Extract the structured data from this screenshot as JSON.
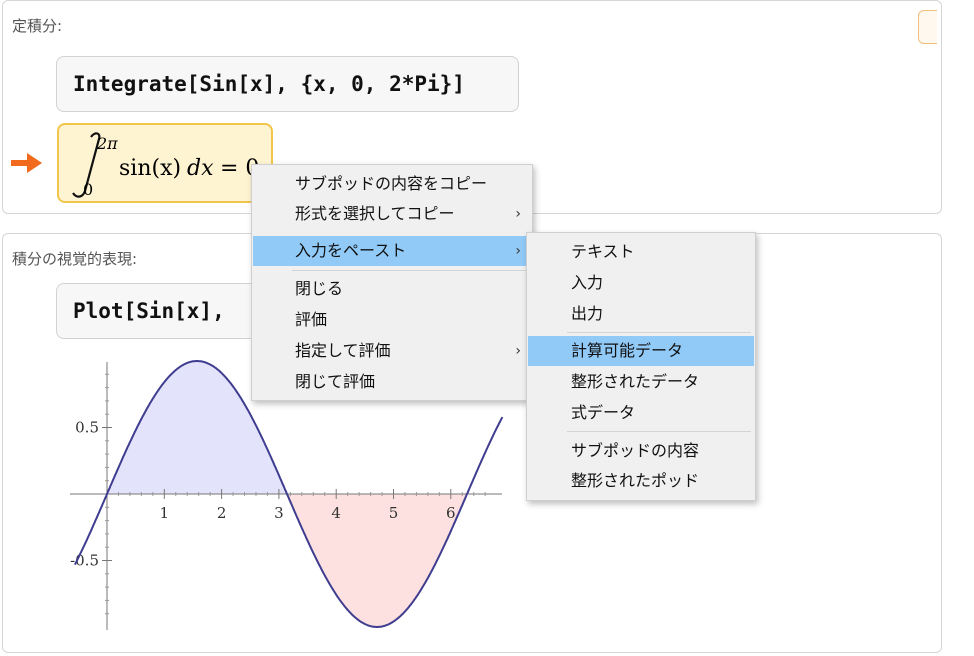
{
  "pod1": {
    "title": "定積分:",
    "input": "Integrate[Sin[x], {x, 0, 2*Pi}]",
    "result": {
      "integrand": "sin(x)",
      "dx": "dx",
      "equals": "= 0",
      "lower": "0",
      "upper": "2π"
    }
  },
  "pod2": {
    "title": "積分の視覚的表現:",
    "input": "Plot[Sin[x],"
  },
  "chart_data": {
    "type": "area",
    "title": "",
    "xlabel": "",
    "ylabel": "",
    "function": "sin(x)",
    "x_ticks": [
      "1",
      "2",
      "3",
      "4",
      "5",
      "6"
    ],
    "y_ticks": [
      "0.5",
      "-0.5"
    ],
    "xlim": [
      -0.65,
      6.9
    ],
    "ylim": [
      -1.2,
      1.2
    ],
    "fill": {
      "from": 0,
      "to": 6.2832,
      "positive_color": "#e3e3fb",
      "negative_color": "#fde0e0"
    },
    "line_color": "#3f3d8f",
    "grid": false
  },
  "context_menu": {
    "items": [
      {
        "label": "サブポッドの内容をコピー",
        "submenu": false
      },
      {
        "label": "形式を選択してコピー",
        "submenu": true
      },
      {
        "label": "入力をペースト",
        "submenu": true,
        "highlighted": true
      },
      {
        "label": "閉じる",
        "submenu": false
      },
      {
        "label": "評価",
        "submenu": false
      },
      {
        "label": "指定して評価",
        "submenu": true
      },
      {
        "label": "閉じて評価",
        "submenu": false
      }
    ],
    "submenu_arrow": "›"
  },
  "paste_submenu": {
    "items": [
      {
        "label": "テキスト"
      },
      {
        "label": "入力"
      },
      {
        "label": "出力"
      },
      {
        "label": "計算可能データ",
        "highlighted": true
      },
      {
        "label": "整形されたデータ"
      },
      {
        "label": "式データ"
      },
      {
        "label": "サブポッドの内容"
      },
      {
        "label": "整形されたポッド"
      }
    ]
  },
  "colors": {
    "accent_arrow": "#f26a1b",
    "highlight": "#91c9f7",
    "result_bg": "#fff4d2"
  }
}
